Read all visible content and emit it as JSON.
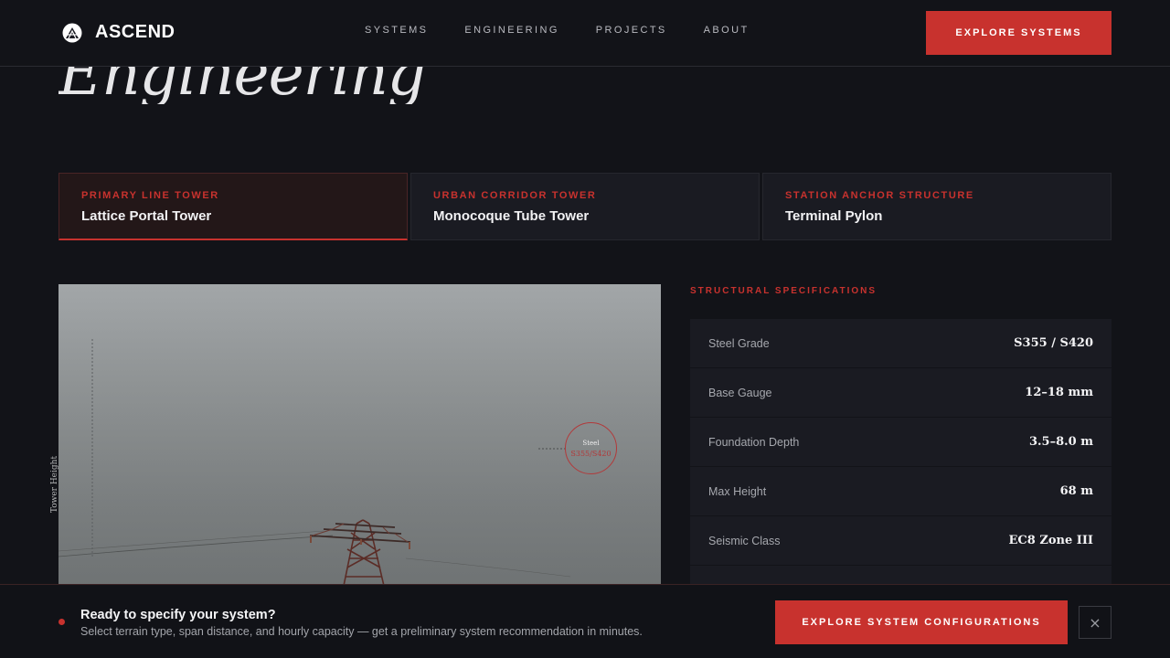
{
  "header": {
    "brand": "ASCEND",
    "nav": [
      "SYSTEMS",
      "ENGINEERING",
      "PROJECTS",
      "ABOUT"
    ],
    "cta_label": "EXPLORE SYSTEMS"
  },
  "page": {
    "title": "Engineering"
  },
  "tabs": [
    {
      "kicker": "PRIMARY LINE TOWER",
      "title": "Lattice Portal Tower",
      "active": true
    },
    {
      "kicker": "URBAN CORRIDOR TOWER",
      "title": "Monocoque Tube Tower",
      "active": false
    },
    {
      "kicker": "STATION ANCHOR STRUCTURE",
      "title": "Terminal Pylon",
      "active": false
    }
  ],
  "photo": {
    "height_label": "Tower Height",
    "badge_line1": "Steel",
    "badge_line2": "S355/S420"
  },
  "specs": {
    "heading": "STRUCTURAL SPECIFICATIONS",
    "rows": [
      {
        "label": "Steel Grade",
        "value": "S355 / S420"
      },
      {
        "label": "Base Gauge",
        "value": "12–18 mm"
      },
      {
        "label": "Foundation Depth",
        "value": "3.5–8.0 m"
      },
      {
        "label": "Max Height",
        "value": "68 m"
      },
      {
        "label": "Seismic Class",
        "value": "EC8 Zone III"
      }
    ]
  },
  "banner": {
    "title": "Ready to specify your system?",
    "subtitle": "Select terrain type, span distance, and hourly capacity — get a preliminary system recommendation in minutes.",
    "cta_label": "EXPLORE SYSTEM CONFIGURATIONS",
    "close_icon": "×"
  },
  "colors": {
    "accent": "#c8322e",
    "background": "#121318",
    "panel": "#1a1b22"
  }
}
